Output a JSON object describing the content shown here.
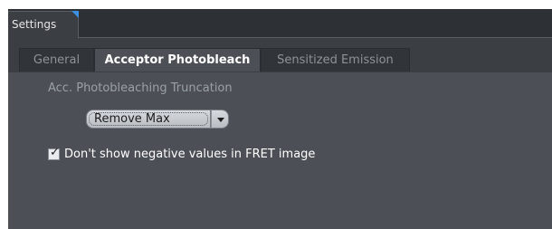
{
  "outer_tab": {
    "label": "Settings"
  },
  "inner_tabs": [
    {
      "label": "General"
    },
    {
      "label": "Acceptor Photobleach"
    },
    {
      "label": "Sensitized Emission"
    }
  ],
  "acceptor_photobleach": {
    "section_label": "Acc. Photobleaching Truncation",
    "truncation_select_value": "Remove Max",
    "checkbox": {
      "label": "Don't show negative values in FRET image",
      "checked": true,
      "mark": "✓"
    }
  }
}
